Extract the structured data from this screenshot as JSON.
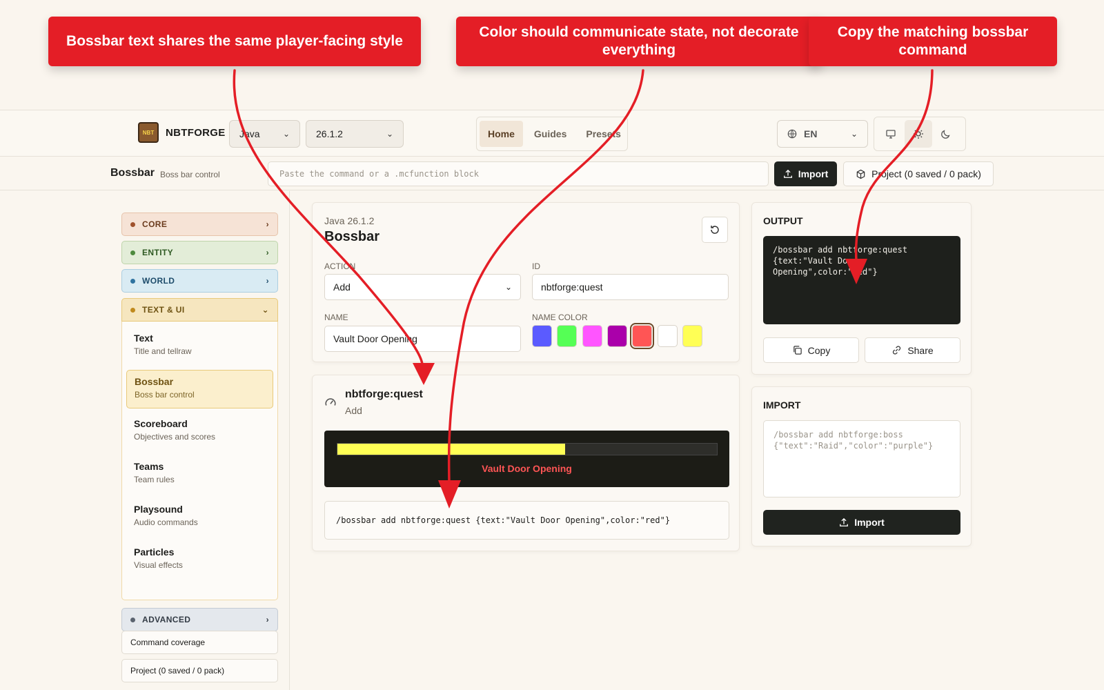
{
  "annotations": [
    "Bossbar text shares the same player-facing style",
    "Color should communicate state, not decorate everything",
    "Copy the matching bossbar command"
  ],
  "topnav": {
    "logo_text": "NBT",
    "brand": "NBTFORGE",
    "edition": "Java",
    "version": "26.1.2",
    "tabs": [
      "Home",
      "Guides",
      "Presets"
    ],
    "language": "EN"
  },
  "subheader": {
    "title": "Bossbar",
    "subtitle": "Boss bar control",
    "paste_placeholder": "Paste the command or a .mcfunction block",
    "import_label": "Import",
    "project_label": "Project (0 saved / 0 pack)"
  },
  "sidebar": {
    "categories": [
      {
        "label": "CORE",
        "color": "#a0522d",
        "bg": "#f6e3d6",
        "border": "#e6c3aa"
      },
      {
        "label": "ENTITY",
        "color": "#4e8a3e",
        "bg": "#e3edd8",
        "border": "#bfd4aa"
      },
      {
        "label": "WORLD",
        "color": "#2f73a0",
        "bg": "#d9ebf3",
        "border": "#abcde0"
      },
      {
        "label": "TEXT & UI",
        "color": "#c08a1e",
        "bg": "#f6e6bf",
        "border": "#e8c97a"
      },
      {
        "label": "ADVANCED",
        "color": "#5b6470",
        "bg": "#e4e8ed",
        "border": "#c3cad3"
      }
    ],
    "items": [
      {
        "title": "Text",
        "sub": "Title and tellraw"
      },
      {
        "title": "Bossbar",
        "sub": "Boss bar control"
      },
      {
        "title": "Scoreboard",
        "sub": "Objectives and scores"
      },
      {
        "title": "Teams",
        "sub": "Team rules"
      },
      {
        "title": "Playsound",
        "sub": "Audio commands"
      },
      {
        "title": "Particles",
        "sub": "Visual effects"
      }
    ],
    "links": [
      "Command coverage",
      "Project (0 saved / 0 pack)"
    ]
  },
  "editor": {
    "version_label": "Java 26.1.2",
    "title": "Bossbar",
    "action_label": "ACTION",
    "action_value": "Add",
    "id_label": "ID",
    "id_value": "nbtforge:quest",
    "name_label": "NAME",
    "name_value": "Vault Door Opening",
    "color_label": "NAME COLOR",
    "colors": [
      "#5b5bff",
      "#55ff55",
      "#ff55ff",
      "#aa00aa",
      "#ff5555",
      "#ffffff",
      "#ffff55"
    ],
    "selected_color": "#ff5555"
  },
  "preview": {
    "id": "nbtforge:quest",
    "action": "Add",
    "progress": 0.6,
    "bar_color": "#ffff55",
    "bar_text": "Vault Door Opening",
    "text_color": "#ff5555",
    "command": "/bossbar add nbtforge:quest {text:\"Vault Door Opening\",color:\"red\"}"
  },
  "output": {
    "heading": "OUTPUT",
    "lines": [
      "/bossbar add nbtforge:quest",
      "{text:\"Vault Door",
      "Opening\",color:\"red\"}"
    ],
    "copy_label": "Copy",
    "share_label": "Share"
  },
  "import_panel": {
    "heading": "IMPORT",
    "placeholder_lines": [
      "/bossbar add nbtforge:boss",
      "{\"text\":\"Raid\",\"color\":\"purple\"}"
    ],
    "import_label": "Import"
  }
}
